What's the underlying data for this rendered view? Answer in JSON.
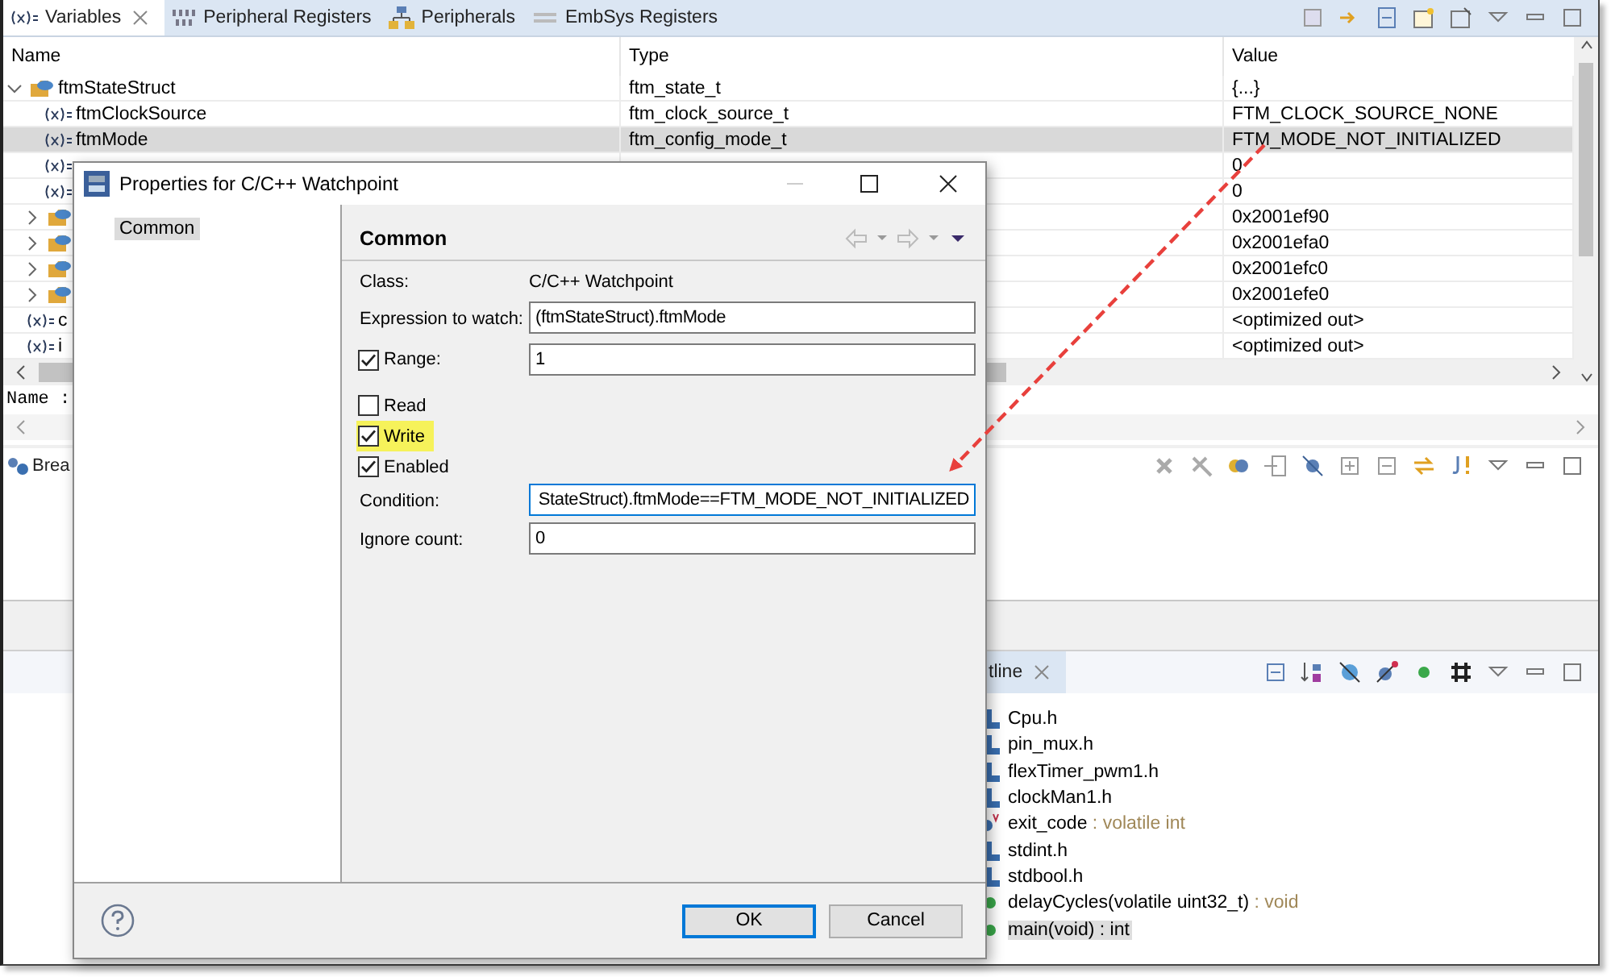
{
  "variables_view": {
    "tabs": [
      {
        "label": "Variables",
        "selected": true
      },
      {
        "label": "Peripheral Registers",
        "selected": false
      },
      {
        "label": "Peripherals",
        "selected": false
      },
      {
        "label": "EmbSys Registers",
        "selected": false
      }
    ],
    "columns": [
      "Name",
      "Type",
      "Value"
    ],
    "rows": [
      {
        "kind": "struct",
        "name": "ftmStateStruct",
        "type": "ftm_state_t",
        "value": "{...}",
        "expanded": true,
        "selected": false,
        "children": [
          {
            "kind": "variable",
            "name": "ftmClockSource",
            "type": "ftm_clock_source_t",
            "value": "FTM_CLOCK_SOURCE_NONE",
            "selected": false
          },
          {
            "kind": "variable",
            "name": "ftmMode",
            "type": "ftm_config_mode_t",
            "value": "FTM_MODE_NOT_INITIALIZED",
            "selected": true
          },
          {
            "kind": "variable",
            "value": "0",
            "selected": false
          },
          {
            "kind": "variable",
            "value": "0",
            "selected": false
          },
          {
            "kind": "struct",
            "value": "0x2001ef90",
            "expanded": false,
            "selected": false
          },
          {
            "kind": "struct",
            "value": "0x2001efa0",
            "expanded": false,
            "selected": false
          },
          {
            "kind": "struct",
            "value": "0x2001efc0",
            "expanded": false,
            "selected": false
          },
          {
            "kind": "struct",
            "value": "0x2001efe0",
            "expanded": false,
            "selected": false
          }
        ]
      },
      {
        "kind": "variable",
        "name": "c",
        "value": "<optimized out>",
        "selected": false
      },
      {
        "kind": "variable",
        "name": "i",
        "value": "<optimized out>",
        "selected": false
      }
    ],
    "detail": "Name :"
  },
  "breakpoints_view": {
    "tab": "Brea"
  },
  "outline_view": {
    "tab": "tline",
    "items": [
      {
        "kind": "include",
        "name": "Cpu.h",
        "selected": false
      },
      {
        "kind": "include",
        "name": "pin_mux.h",
        "selected": false
      },
      {
        "kind": "include",
        "name": "flexTimer_pwm1.h",
        "selected": false
      },
      {
        "kind": "include",
        "name": "clockMan1.h",
        "selected": false
      },
      {
        "kind": "variable",
        "name": "exit_code",
        "detail": " : volatile int",
        "selected": false
      },
      {
        "kind": "include",
        "name": "stdint.h",
        "selected": false
      },
      {
        "kind": "include",
        "name": "stdbool.h",
        "selected": false
      },
      {
        "kind": "function",
        "name": "delayCycles(volatile uint32_t)",
        "detail": " : void",
        "selected": false
      },
      {
        "kind": "function",
        "name": "main(void) : int",
        "selected": true
      }
    ]
  },
  "dialog": {
    "title": "Properties for C/C++ Watchpoint",
    "nav": [
      {
        "label": "Common",
        "selected": true
      }
    ],
    "page_title": "Common",
    "fields": [
      {
        "kind": "info",
        "label": "Class:",
        "value": "C/C++ Watchpoint"
      },
      {
        "kind": "text",
        "label": "Expression to watch:",
        "value": "(ftmStateStruct).ftmMode",
        "focused": false
      },
      {
        "kind": "check-text",
        "label": "Range:",
        "checked": true,
        "value": "1",
        "focused": false
      },
      {
        "kind": "check",
        "label": "Read",
        "checked": false,
        "highlighted": false
      },
      {
        "kind": "check",
        "label": "Write",
        "checked": true,
        "highlighted": true
      },
      {
        "kind": "check",
        "label": "Enabled",
        "checked": true,
        "highlighted": false
      },
      {
        "kind": "text",
        "label": "Condition:",
        "value": "StateStruct).ftmMode==FTM_MODE_NOT_INITIALIZED",
        "focused": true
      },
      {
        "kind": "text",
        "label": "Ignore count:",
        "value": "0",
        "focused": false
      }
    ],
    "buttons": [
      {
        "label": "OK",
        "default": true
      },
      {
        "label": "Cancel",
        "default": false
      }
    ]
  }
}
